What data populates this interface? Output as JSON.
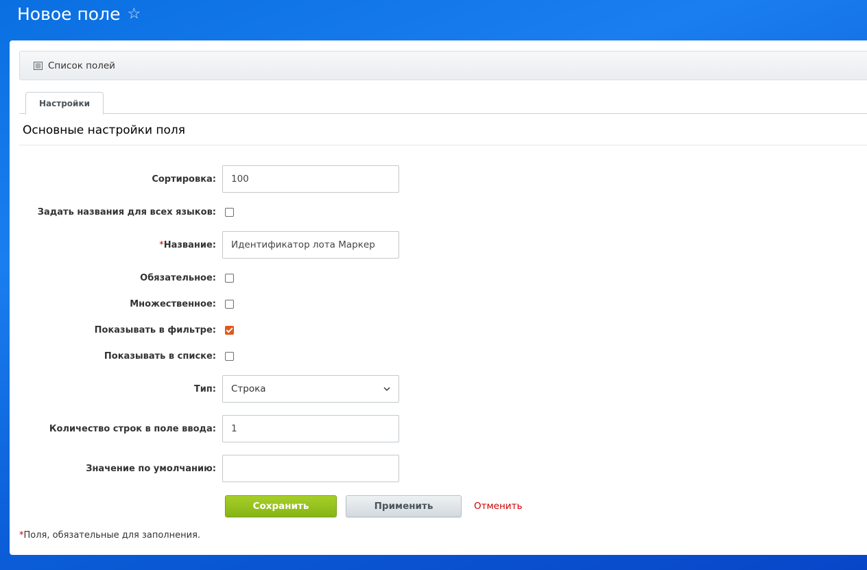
{
  "page": {
    "title": "Новое поле"
  },
  "toolbar": {
    "list_label": "Список полей"
  },
  "tabs": [
    {
      "label": "Настройки"
    }
  ],
  "section": {
    "title": "Основные настройки поля"
  },
  "form": {
    "sort": {
      "label": "Сортировка:",
      "value": "100"
    },
    "all_languages": {
      "label": "Задать названия для всех языков:",
      "checked": false
    },
    "name": {
      "required_mark": "*",
      "label": "Название:",
      "value": "Идентификатор лота Маркер"
    },
    "mandatory": {
      "label": "Обязательное:",
      "checked": false
    },
    "multiple": {
      "label": "Множественное:",
      "checked": false
    },
    "show_in_filter": {
      "label": "Показывать в фильтре:",
      "checked": true
    },
    "show_in_list": {
      "label": "Показывать в списке:",
      "checked": false
    },
    "type": {
      "label": "Тип:",
      "value": "Строка"
    },
    "rows_count": {
      "label": "Количество строк в поле ввода:",
      "value": "1"
    },
    "default_value": {
      "label": "Значение по умолчанию:",
      "value": ""
    }
  },
  "buttons": {
    "save": "Сохранить",
    "apply": "Применить",
    "cancel": "Отменить"
  },
  "footnote": {
    "mark": "*",
    "text": "Поля, обязательные для заполнения."
  },
  "colors": {
    "accent_checkbox": "#e2571e",
    "save_button": "#94c11f",
    "cancel_link": "#cc0000",
    "required_mark": "#d20000"
  },
  "icons": {
    "favorite": "star-icon",
    "list": "list-icon",
    "select_arrow": "chevron-down-icon"
  }
}
